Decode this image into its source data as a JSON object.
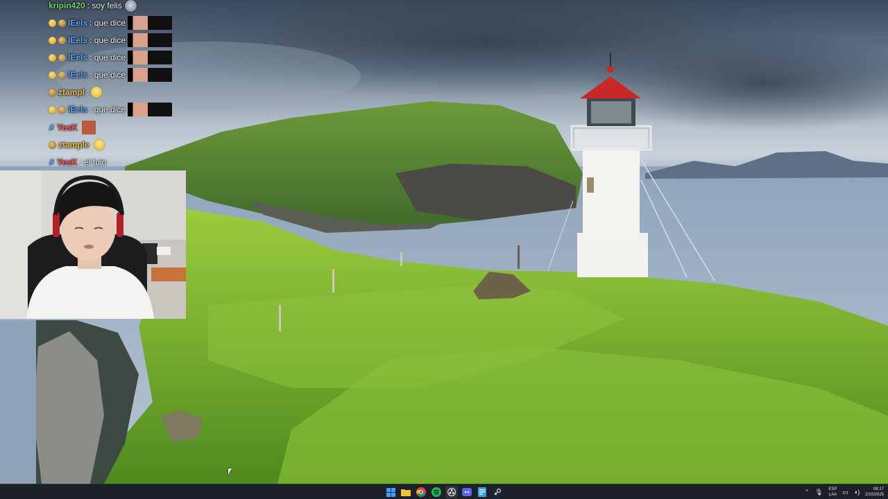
{
  "chat": {
    "messages": [
      {
        "user": "kripin420",
        "color": "#6fd66f",
        "text": ": soy felis",
        "badges": [],
        "emote": "laugh"
      },
      {
        "user": "lEels",
        "color": "#5aa7ff",
        "text": ": que dice",
        "badges": [
          "gold",
          "bronze"
        ],
        "emote": "photo"
      },
      {
        "user": "lEels",
        "color": "#5aa7ff",
        "text": ": que dice",
        "badges": [
          "gold",
          "bronze"
        ],
        "emote": "photo"
      },
      {
        "user": "lEels",
        "color": "#5aa7ff",
        "text": ": que dice",
        "badges": [
          "gold",
          "bronze"
        ],
        "emote": "photo"
      },
      {
        "user": "lEels",
        "color": "#5aa7ff",
        "text": ": que dice",
        "badges": [
          "gold",
          "bronze"
        ],
        "emote": "photo"
      },
      {
        "user": "ztampl",
        "color": "#f0c24a",
        "text": " :",
        "badges": [
          "bronze"
        ],
        "emote": "face"
      },
      {
        "user": "lEels",
        "color": "#5aa7ff",
        "text": ": que dice",
        "badges": [
          "gold",
          "bronze"
        ],
        "emote": "photo"
      },
      {
        "user": "YesK",
        "color": "#ff5a5a",
        "text": "",
        "badges": [
          "blue-x"
        ],
        "emote": "small"
      },
      {
        "user": "ztample",
        "color": "#f0c24a",
        "text": "",
        "badges": [
          "bronze"
        ],
        "emote": "face"
      },
      {
        "user": "YesK",
        "color": "#ff5a5a",
        "text": ": el tuio",
        "badges": [
          "blue-x"
        ],
        "emote": ""
      }
    ]
  },
  "taskbar": {
    "apps": [
      {
        "name": "start",
        "icon": "windows-icon"
      },
      {
        "name": "file-explorer",
        "icon": "folder-icon"
      },
      {
        "name": "chrome",
        "icon": "chrome-icon"
      },
      {
        "name": "spotify",
        "icon": "spotify-icon"
      },
      {
        "name": "obs",
        "icon": "obs-icon"
      },
      {
        "name": "discord",
        "icon": "discord-icon"
      },
      {
        "name": "notepad",
        "icon": "notepad-icon"
      },
      {
        "name": "steam",
        "icon": "steam-icon"
      }
    ],
    "lang_top": "ESP",
    "lang_bottom": "LAA",
    "time": "08:17",
    "date": "2/10/2025"
  },
  "colors": {
    "taskbar_bg": "#1c2027",
    "grass": "#7fb83a",
    "sea": "#8ea3ba",
    "lighthouse_roof": "#c8282a"
  }
}
